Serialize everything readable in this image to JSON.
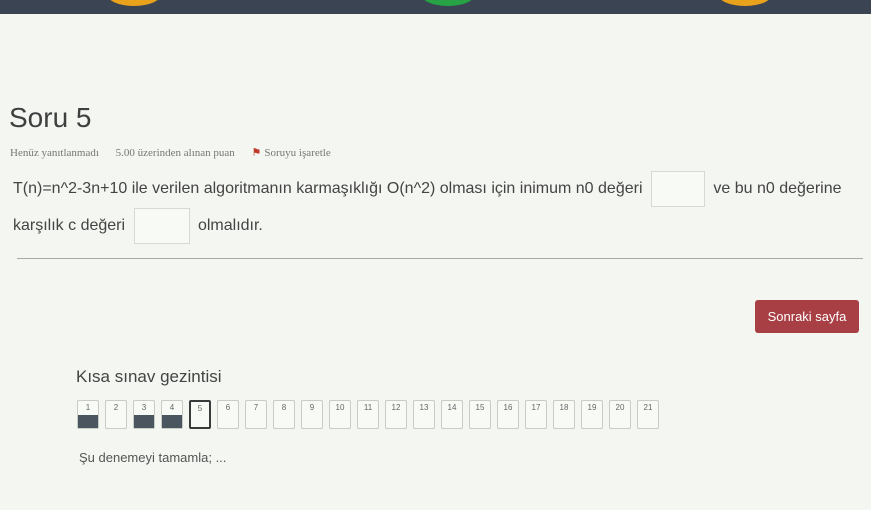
{
  "question": {
    "title": "Soru 5",
    "status": "Henüz yanıtlanmadı",
    "points": "5.00 üzerinden alınan puan",
    "flag_label": "Soruyu işaretle",
    "text_part1": "T(n)=n^2-3n+10 ile verilen algoritmanın karmaşıklığı O(n^2) olması için inimum n0 değeri",
    "text_part2": "ve bu n0 değerine",
    "text_part3": "karşılık c değeri",
    "text_part4": "olmalıdır.",
    "answer_n0": "",
    "answer_c": ""
  },
  "next_button_label": "Sonraki sayfa",
  "navigation": {
    "title": "Kısa sınav gezintisi",
    "items": [
      {
        "num": "1",
        "answered": true,
        "current": false
      },
      {
        "num": "2",
        "answered": false,
        "current": false
      },
      {
        "num": "3",
        "answered": true,
        "current": false
      },
      {
        "num": "4",
        "answered": true,
        "current": false
      },
      {
        "num": "5",
        "answered": false,
        "current": true
      },
      {
        "num": "6",
        "answered": false,
        "current": false
      },
      {
        "num": "7",
        "answered": false,
        "current": false
      },
      {
        "num": "8",
        "answered": false,
        "current": false
      },
      {
        "num": "9",
        "answered": false,
        "current": false
      },
      {
        "num": "10",
        "answered": false,
        "current": false
      },
      {
        "num": "11",
        "answered": false,
        "current": false
      },
      {
        "num": "12",
        "answered": false,
        "current": false
      },
      {
        "num": "13",
        "answered": false,
        "current": false
      },
      {
        "num": "14",
        "answered": false,
        "current": false
      },
      {
        "num": "15",
        "answered": false,
        "current": false
      },
      {
        "num": "16",
        "answered": false,
        "current": false
      },
      {
        "num": "17",
        "answered": false,
        "current": false
      },
      {
        "num": "18",
        "answered": false,
        "current": false
      },
      {
        "num": "19",
        "answered": false,
        "current": false
      },
      {
        "num": "20",
        "answered": false,
        "current": false
      },
      {
        "num": "21",
        "answered": false,
        "current": false
      }
    ],
    "finish_link": "Şu denemeyi tamamla; ..."
  },
  "colors": {
    "accent_button": "#a83f44",
    "answered_fill": "#4a5560",
    "topbar": "#3b4452"
  }
}
